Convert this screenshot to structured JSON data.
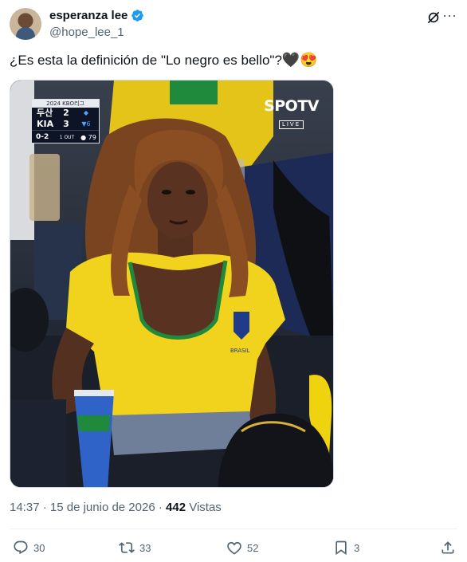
{
  "author": {
    "display_name": "esperanza lee",
    "handle": "@hope_lee_1",
    "verified": true,
    "avatar_icon": "avatar-icon"
  },
  "tweet": {
    "text": "¿Es esta la definición de \"Lo negro es bello\"?",
    "emoji": "🖤😍"
  },
  "media": {
    "scorebug": {
      "league": "2024 KBO리그",
      "team1": "두산",
      "score1": "2",
      "team2": "KIA",
      "score2": "3",
      "inning": "▼6",
      "count": "0-2",
      "outs": "1 OUT",
      "pitch_count": "● 79"
    },
    "broadcaster": "SPOTV",
    "broadcast_status": "LIVE",
    "jersey_text": "BRASIL",
    "colors": {
      "jersey": "#f1d21c",
      "collar": "#1f8a3c",
      "skin": "#5a3222",
      "hair": "#8a4e22"
    }
  },
  "meta": {
    "time": "14:37",
    "separator": "·",
    "date": "15 de junio de 2026",
    "views_count": "442",
    "views_label": "Vistas"
  },
  "actions": {
    "reply": "30",
    "retweet": "33",
    "like": "52",
    "bookmark": "3"
  },
  "colors": {
    "accent": "#1d9bf0",
    "secondary_text": "#536471"
  }
}
